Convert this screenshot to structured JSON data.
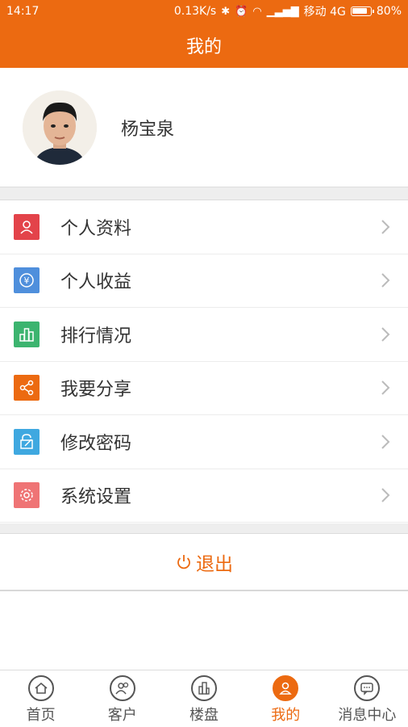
{
  "statusbar": {
    "time": "14:17",
    "speed": "0.13K/s",
    "carrier": "移动 4G",
    "battery": "80%"
  },
  "header": {
    "title": "我的"
  },
  "profile": {
    "name": "杨宝泉"
  },
  "menu": [
    {
      "label": "个人资料",
      "icon": "user-icon",
      "color": "#e3434a"
    },
    {
      "label": "个人收益",
      "icon": "yen-coin-icon",
      "color": "#4f8fdc"
    },
    {
      "label": "排行情况",
      "icon": "ranking-icon",
      "color": "#3cb46f"
    },
    {
      "label": "我要分享",
      "icon": "share-icon",
      "color": "#ec6a11"
    },
    {
      "label": "修改密码",
      "icon": "lock-edit-icon",
      "color": "#3fa8e0"
    },
    {
      "label": "系统设置",
      "icon": "gear-icon",
      "color": "#ef7475"
    }
  ],
  "logout": {
    "label": "退出"
  },
  "tabs": [
    {
      "label": "首页",
      "icon": "home-icon"
    },
    {
      "label": "客户",
      "icon": "customers-icon"
    },
    {
      "label": "楼盘",
      "icon": "building-icon"
    },
    {
      "label": "我的",
      "icon": "profile-icon",
      "active": true
    },
    {
      "label": "消息中心",
      "icon": "message-icon"
    }
  ],
  "colors": {
    "accent": "#ec6a11"
  }
}
